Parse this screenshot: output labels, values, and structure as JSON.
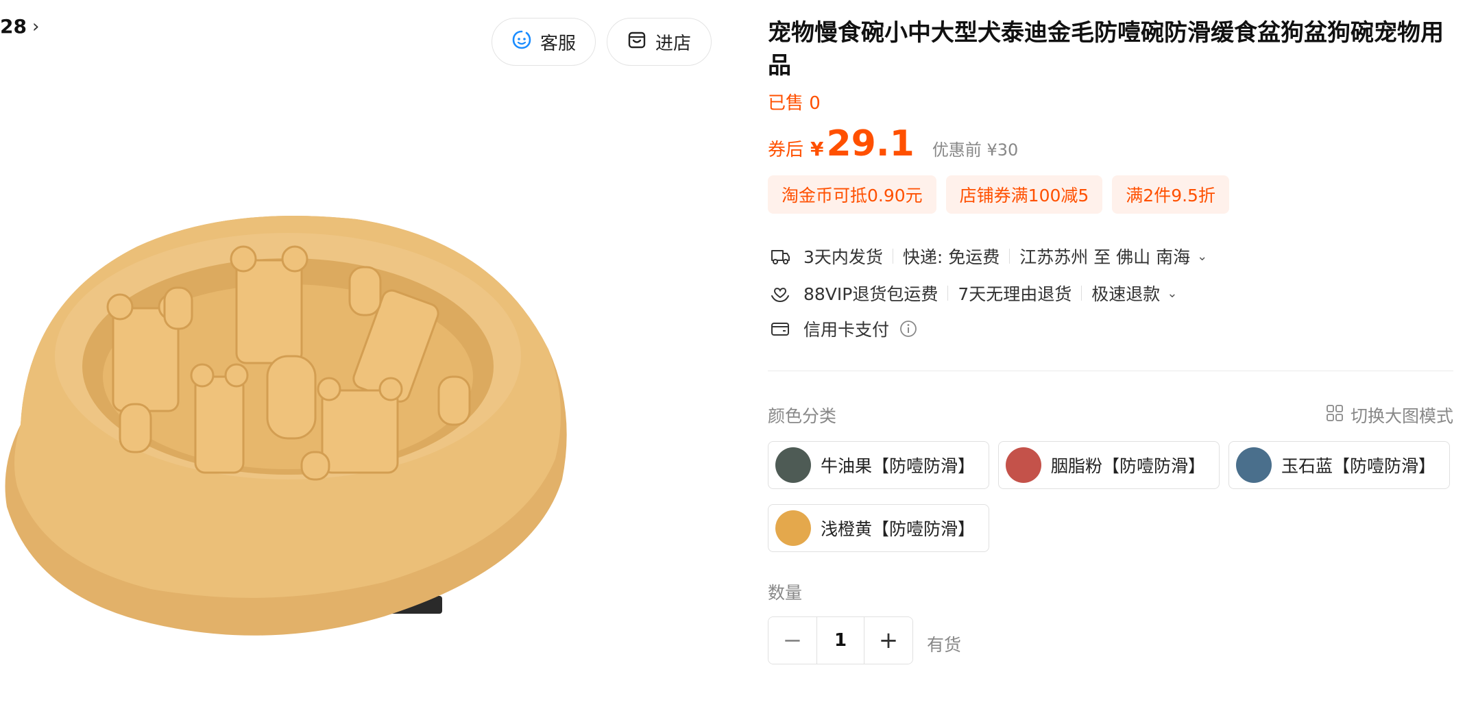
{
  "breadcrumb": {
    "text": "28",
    "chevron": "›"
  },
  "header_buttons": {
    "service": {
      "label": "客服",
      "icon": "chat-face-icon",
      "icon_color": "#1a8cff"
    },
    "store": {
      "label": "进店",
      "icon": "store-icon"
    }
  },
  "product": {
    "title": "宠物慢食碗小中大型犬泰迪金毛防噎碗防滑缓食盆狗盆狗碗宠物用品",
    "sold": "已售 0",
    "image_color": "#e9bd72"
  },
  "price": {
    "prefix": "券后",
    "currency": "¥",
    "value": "29.1",
    "original": "优惠前 ¥30"
  },
  "promos": [
    "淘金币可抵0.90元",
    "店铺券满100减5",
    "满2件9.5折"
  ],
  "shipping": {
    "items": [
      "3天内发货",
      "快递: 免运费",
      "江苏苏州 至 佛山 南海"
    ],
    "icon": "delivery-truck-icon"
  },
  "guarantee": {
    "items": [
      "88VIP退货包运费",
      "7天无理由退货",
      "极速退款"
    ],
    "icon": "hand-heart-icon"
  },
  "payment": {
    "label": "信用卡支付",
    "icon": "card-icon"
  },
  "color_section": {
    "label": "颜色分类",
    "switch_label": "切换大图模式",
    "options": [
      {
        "name": "牛油果【防噎防滑】",
        "color": "#4e5b55"
      },
      {
        "name": "胭脂粉【防噎防滑】",
        "color": "#c4524a"
      },
      {
        "name": "玉石蓝【防噎防滑】",
        "color": "#4a6f8c"
      },
      {
        "name": "浅橙黄【防噎防滑】",
        "color": "#e4a84c"
      }
    ]
  },
  "quantity": {
    "label": "数量",
    "value": "1",
    "minus": "−",
    "plus": "+",
    "stock": "有货"
  },
  "colors": {
    "accent": "#ff5000",
    "promo_bg": "#fff1eb"
  }
}
